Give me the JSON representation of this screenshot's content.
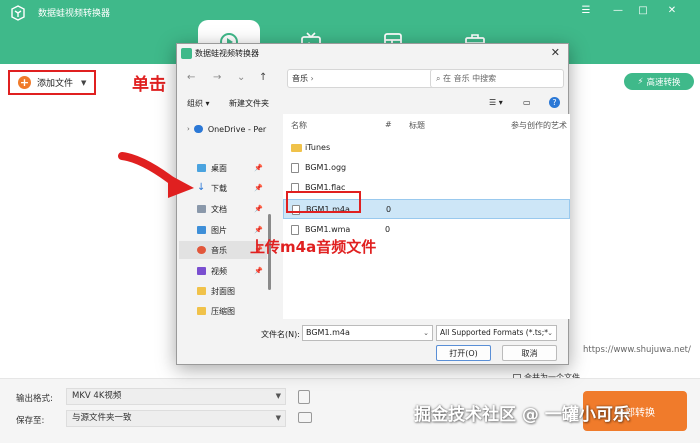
{
  "app": {
    "title": "数据蛙视频转换器",
    "window_controls": [
      "☰",
      "—",
      "□",
      "✕"
    ],
    "accent_color": "#3fb98a",
    "orange_color": "#f07b2b"
  },
  "nav_tabs": [
    {
      "icon": "convert-icon"
    },
    {
      "icon": "tv-icon"
    },
    {
      "icon": "grid-icon"
    },
    {
      "icon": "toolbox-icon"
    }
  ],
  "toolbar": {
    "add_file_label": "添加文件",
    "fast_convert_label": "高速转换"
  },
  "annotations": {
    "click_hint": "单击【添加文件】",
    "upload_hint": "上传m4a音频文件",
    "watermark": "掘金技术社区 @ 一罐小可乐"
  },
  "dialog": {
    "title": "数据蛙视频转换器",
    "address": "音乐",
    "search_placeholder": "在 音乐 中搜索",
    "organize_label": "组织",
    "new_folder_label": "新建文件夹",
    "sidebar": [
      {
        "label": "OneDrive - Per",
        "icon": "onedrive-icon",
        "pinned": false
      },
      {
        "label": "桌面",
        "icon": "desktop-icon",
        "pinned": true
      },
      {
        "label": "下载",
        "icon": "download-icon",
        "pinned": true
      },
      {
        "label": "文档",
        "icon": "documents-icon",
        "pinned": true
      },
      {
        "label": "图片",
        "icon": "pictures-icon",
        "pinned": true
      },
      {
        "label": "音乐",
        "icon": "music-icon",
        "pinned": true,
        "selected": true
      },
      {
        "label": "视频",
        "icon": "videos-icon",
        "pinned": true
      },
      {
        "label": "封面图",
        "icon": "folder-icon",
        "pinned": false
      },
      {
        "label": "压缩图",
        "icon": "folder-icon",
        "pinned": false
      }
    ],
    "columns": [
      "名称",
      "#",
      "标题",
      "参与创作的艺术"
    ],
    "files": [
      {
        "name": "iTunes",
        "type": "folder",
        "num": ""
      },
      {
        "name": "BGM1.ogg",
        "type": "file",
        "num": ""
      },
      {
        "name": "BGM1.flac",
        "type": "file",
        "num": ""
      },
      {
        "name": "BGM1.m4a",
        "type": "file",
        "num": "0",
        "selected": true
      },
      {
        "name": "BGM1.wma",
        "type": "file",
        "num": "0"
      }
    ],
    "filename_label": "文件名(N):",
    "filename_value": "BGM1.m4a",
    "filetype_value": "All Supported Formats (*.ts;*",
    "open_button": "打开(O)",
    "cancel_button": "取消"
  },
  "bottom": {
    "output_format_label": "输出格式:",
    "output_format_value": "MKV 4K视频",
    "save_to_label": "保存至:",
    "save_to_value": "与源文件夹一致",
    "website": "https://www.shujuwa.net/",
    "merge_label": "合并为一个文件",
    "convert_label": "全部转换"
  }
}
